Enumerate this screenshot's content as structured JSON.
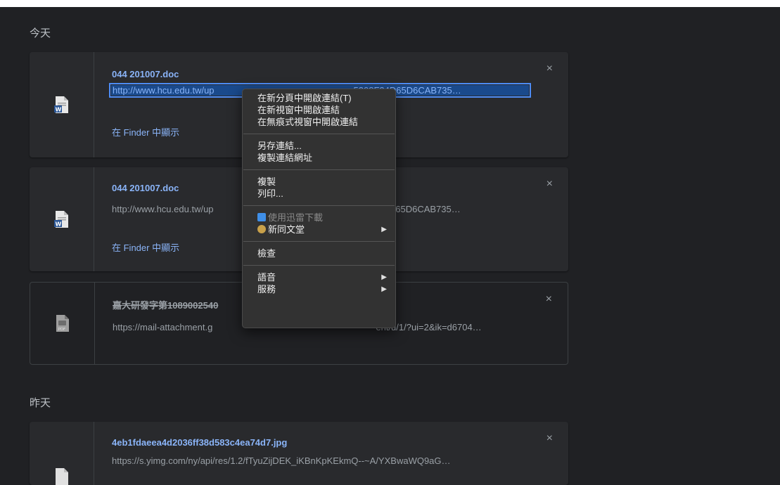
{
  "sections": [
    {
      "label": "今天"
    },
    {
      "label": "昨天"
    }
  ],
  "downloads": [
    {
      "filename": "044 201007.doc",
      "url": "http://www.hcu.edu.tw/upload/...5308F34D65D6CAB735...",
      "url_visible_left": "http://www.hcu.edu.tw/up",
      "url_visible_right": "5308F34D65D6CAB735…",
      "finder": "在 Finder 中顯示",
      "close": "×",
      "icon": "word-doc-icon"
    },
    {
      "filename": "044 201007.doc",
      "url_visible_left": "http://www.hcu.edu.tw/up",
      "url_visible_right": "5308F34D65D6CAB735…",
      "finder": "在 Finder 中顯示",
      "close": "×",
      "icon": "word-doc-icon"
    },
    {
      "filename_left": "嘉大研發字第10890025​40",
      "url_left": "https://mail-attachment.g",
      "url_right": "ent/u/1/?ui=2&ik=d6704…",
      "close": "×",
      "icon": "pdf-icon",
      "removed": true
    },
    {
      "filename": "4eb1fdaeea4d2036ff38d583c4ea74d7.jpg",
      "url": "https://s.yimg.com/ny/api/res/1.2/fTyuZijDEK_iKBnKpKEkmQ--~A/YXBwaWQ9aG…",
      "close": "×",
      "icon": "image-file-icon"
    }
  ],
  "context_menu": {
    "groups": [
      [
        {
          "label": "在新分頁中開啟連結(T)"
        },
        {
          "label": "在新視窗中開啟連結"
        },
        {
          "label": "在無痕式視窗中開啟連結"
        }
      ],
      [
        {
          "label": "另存連結..."
        },
        {
          "label": "複製連結網址"
        }
      ],
      [
        {
          "label": "複製"
        },
        {
          "label": "列印..."
        }
      ],
      [
        {
          "label": "使用迅雷下載",
          "disabled": true,
          "icon": "thunder-bird-icon"
        },
        {
          "label": "新同文堂",
          "submenu": true,
          "icon": "xintongwentang-icon"
        }
      ],
      [
        {
          "label": "檢查"
        }
      ],
      [
        {
          "label": "語音",
          "submenu": true
        },
        {
          "label": "服務",
          "submenu": true
        }
      ]
    ],
    "arrow": "▶"
  },
  "colors": {
    "background": "#202124",
    "card": "#292a2d",
    "link": "#8ab4f8",
    "muted": "#9aa0a6",
    "menu": "#323232"
  }
}
